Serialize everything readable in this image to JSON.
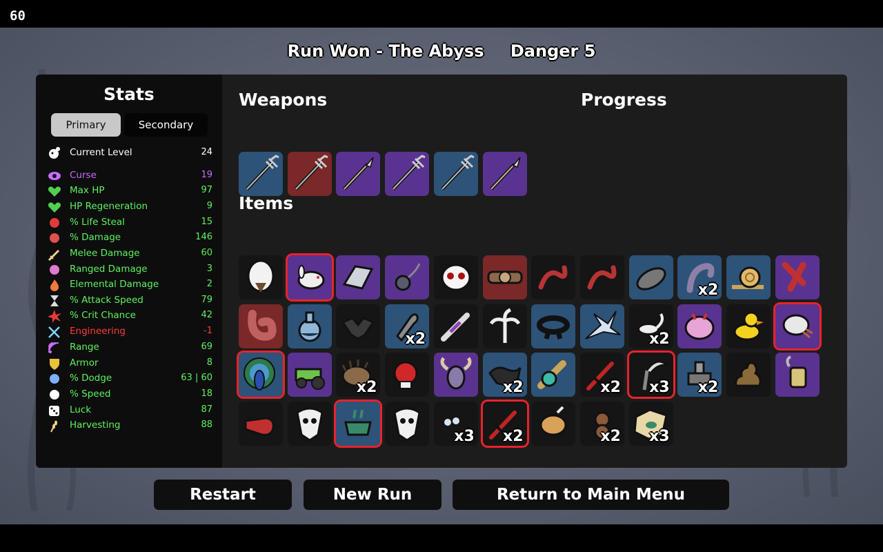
{
  "fps": "60",
  "header": {
    "run_result": "Run Won - The Abyss",
    "danger": "Danger 5"
  },
  "stats": {
    "title": "Stats",
    "tabs": {
      "primary": "Primary",
      "secondary": "Secondary"
    },
    "rows": [
      {
        "label": "Current Level",
        "value": "24",
        "tone": "neu",
        "icon": "level-up-icon",
        "color": "#ffffff"
      },
      {
        "label": "Curse",
        "value": "19",
        "tone": "cur",
        "icon": "curse-eye-icon",
        "color": "#c96cff"
      },
      {
        "label": "Max HP",
        "value": "97",
        "tone": "pos",
        "icon": "heart-icon",
        "color": "#4fd04f"
      },
      {
        "label": "HP Regeneration",
        "value": "9",
        "tone": "pos",
        "icon": "regen-heart-icon",
        "color": "#4fd04f"
      },
      {
        "label": "% Life Steal",
        "value": "15",
        "tone": "pos",
        "icon": "lifesteal-icon",
        "color": "#e23a3a"
      },
      {
        "label": "% Damage",
        "value": "146",
        "tone": "pos",
        "icon": "fist-icon",
        "color": "#e05050"
      },
      {
        "label": "Melee Damage",
        "value": "60",
        "tone": "pos",
        "icon": "sword-icon",
        "color": "#e8d28a"
      },
      {
        "label": "Ranged Damage",
        "value": "3",
        "tone": "pos",
        "icon": "bow-icon",
        "color": "#e07ad0"
      },
      {
        "label": "Elemental Damage",
        "value": "2",
        "tone": "pos",
        "icon": "flame-icon",
        "color": "#f07a3a"
      },
      {
        "label": "% Attack Speed",
        "value": "79",
        "tone": "pos",
        "icon": "hourglass-icon",
        "color": "#dddddd"
      },
      {
        "label": "% Crit Chance",
        "value": "42",
        "tone": "pos",
        "icon": "crit-burst-icon",
        "color": "#e83a3a"
      },
      {
        "label": "Engineering",
        "value": "-1",
        "tone": "neg",
        "icon": "wrench-icon",
        "color": "#7fd6ff"
      },
      {
        "label": "Range",
        "value": "69",
        "tone": "pos",
        "icon": "range-waves-icon",
        "color": "#c96cff"
      },
      {
        "label": "Armor",
        "value": "8",
        "tone": "pos",
        "icon": "shield-icon",
        "color": "#e8c23a"
      },
      {
        "label": "% Dodge",
        "value": "63 | 60",
        "tone": "pos",
        "icon": "dodge-icon",
        "color": "#7fb0ff"
      },
      {
        "label": "% Speed",
        "value": "18",
        "tone": "pos",
        "icon": "boot-icon",
        "color": "#ffffff"
      },
      {
        "label": "Luck",
        "value": "87",
        "tone": "pos",
        "icon": "dice-icon",
        "color": "#ffffff"
      },
      {
        "label": "Harvesting",
        "value": "88",
        "tone": "pos",
        "icon": "wheat-icon",
        "color": "#f0d48a"
      }
    ]
  },
  "weapons": {
    "title": "Weapons",
    "slots": [
      {
        "tier": 2,
        "icon": "trident-icon"
      },
      {
        "tier": 4,
        "icon": "trident-icon"
      },
      {
        "tier": 3,
        "icon": "spear-icon"
      },
      {
        "tier": 3,
        "icon": "trident-icon"
      },
      {
        "tier": 2,
        "icon": "trident-icon"
      },
      {
        "tier": 3,
        "icon": "spear-icon"
      }
    ]
  },
  "progress": {
    "title": "Progress"
  },
  "items": {
    "title": "Items",
    "slots": [
      {
        "tier": 0,
        "icon": "bald-egg-head-icon",
        "count": "",
        "highlight": false
      },
      {
        "tier": 3,
        "icon": "white-rabbit-icon",
        "count": "",
        "highlight": true
      },
      {
        "tier": 3,
        "icon": "metal-plate-icon",
        "count": "",
        "highlight": false
      },
      {
        "tier": 3,
        "icon": "flail-icon",
        "count": "",
        "highlight": false
      },
      {
        "tier": 0,
        "icon": "ghost-mask-icon",
        "count": "",
        "highlight": false
      },
      {
        "tier": 4,
        "icon": "cow-belt-icon",
        "count": "",
        "highlight": false
      },
      {
        "tier": 0,
        "icon": "red-tentacle-icon",
        "count": "",
        "highlight": false
      },
      {
        "tier": 0,
        "icon": "red-claw-icon",
        "count": "",
        "highlight": false
      },
      {
        "tier": 2,
        "icon": "stone-icon",
        "count": "",
        "highlight": false
      },
      {
        "tier": 2,
        "icon": "tentacle-icon",
        "count": "x2",
        "highlight": false
      },
      {
        "tier": 2,
        "icon": "snail-icon",
        "count": "",
        "highlight": false
      },
      {
        "tier": 3,
        "icon": "scarf-icon",
        "count": "",
        "highlight": false
      },
      {
        "tier": 4,
        "icon": "stomach-icon",
        "count": "",
        "highlight": false
      },
      {
        "tier": 2,
        "icon": "potion-flask-icon",
        "count": "",
        "highlight": false
      },
      {
        "tier": 0,
        "icon": "bat-icon",
        "count": "",
        "highlight": false
      },
      {
        "tier": 2,
        "icon": "bullet-icon",
        "count": "x2",
        "highlight": false
      },
      {
        "tier": 0,
        "icon": "syringe-icon",
        "count": "",
        "highlight": false
      },
      {
        "tier": 0,
        "icon": "palm-tree-icon",
        "count": "",
        "highlight": false
      },
      {
        "tier": 2,
        "icon": "black-belt-icon",
        "count": "",
        "highlight": false
      },
      {
        "tier": 2,
        "icon": "ice-shards-icon",
        "count": "",
        "highlight": false
      },
      {
        "tier": 0,
        "icon": "scorpion-icon",
        "count": "x2",
        "highlight": false
      },
      {
        "tier": 3,
        "icon": "pink-brain-icon",
        "count": "",
        "highlight": false
      },
      {
        "tier": 0,
        "icon": "rubber-duck-icon",
        "count": "",
        "highlight": false
      },
      {
        "tier": 3,
        "icon": "hermit-shell-icon",
        "count": "",
        "highlight": true
      },
      {
        "tier": 2,
        "icon": "peacock-icon",
        "count": "",
        "highlight": true
      },
      {
        "tier": 3,
        "icon": "tractor-icon",
        "count": "",
        "highlight": false
      },
      {
        "tier": 0,
        "icon": "hedgehog-icon",
        "count": "x2",
        "highlight": false
      },
      {
        "tier": 0,
        "icon": "boxing-glove-icon",
        "count": "",
        "highlight": false
      },
      {
        "tier": 3,
        "icon": "horned-mask-icon",
        "count": "",
        "highlight": false
      },
      {
        "tier": 2,
        "icon": "black-cloth-icon",
        "count": "x2",
        "highlight": false
      },
      {
        "tier": 2,
        "icon": "spyglass-icon",
        "count": "",
        "highlight": false
      },
      {
        "tier": 0,
        "icon": "dagger-icon",
        "count": "x2",
        "highlight": false
      },
      {
        "tier": 0,
        "icon": "scythe-blade-icon",
        "count": "x3",
        "highlight": true
      },
      {
        "tier": 2,
        "icon": "turret-icon",
        "count": "x2",
        "highlight": false
      },
      {
        "tier": 0,
        "icon": "dung-icon",
        "count": "",
        "highlight": false
      },
      {
        "tier": 3,
        "icon": "lantern-potion-icon",
        "count": "",
        "highlight": false
      },
      {
        "tier": 0,
        "icon": "whistle-icon",
        "count": "",
        "highlight": false
      },
      {
        "tier": 0,
        "icon": "animal-skull-icon",
        "count": "",
        "highlight": false
      },
      {
        "tier": 2,
        "icon": "tea-cup-icon",
        "count": "",
        "highlight": true
      },
      {
        "tier": 0,
        "icon": "tooth-skull-icon",
        "count": "",
        "highlight": false
      },
      {
        "tier": 0,
        "icon": "pearls-icon",
        "count": "x3",
        "highlight": false
      },
      {
        "tier": 0,
        "icon": "red-sword-icon",
        "count": "x2",
        "highlight": true
      },
      {
        "tier": 0,
        "icon": "lion-cub-icon",
        "count": "",
        "highlight": false
      },
      {
        "tier": 0,
        "icon": "monkey-icon",
        "count": "x2",
        "highlight": false
      },
      {
        "tier": 0,
        "icon": "treasure-map-icon",
        "count": "x3",
        "highlight": false
      }
    ]
  },
  "buttons": {
    "restart": "Restart",
    "new_run": "New Run",
    "main_menu": "Return to Main Menu"
  },
  "colors": {
    "highlight": "#e8232c",
    "positive": "#5ef25e",
    "negative": "#ff3b3b",
    "curse": "#c96cff",
    "tier_common": "#2a2a2a",
    "tier_uncommon": "#2d5378",
    "tier_rare": "#5a3390",
    "tier_legendary": "#7a2828"
  }
}
